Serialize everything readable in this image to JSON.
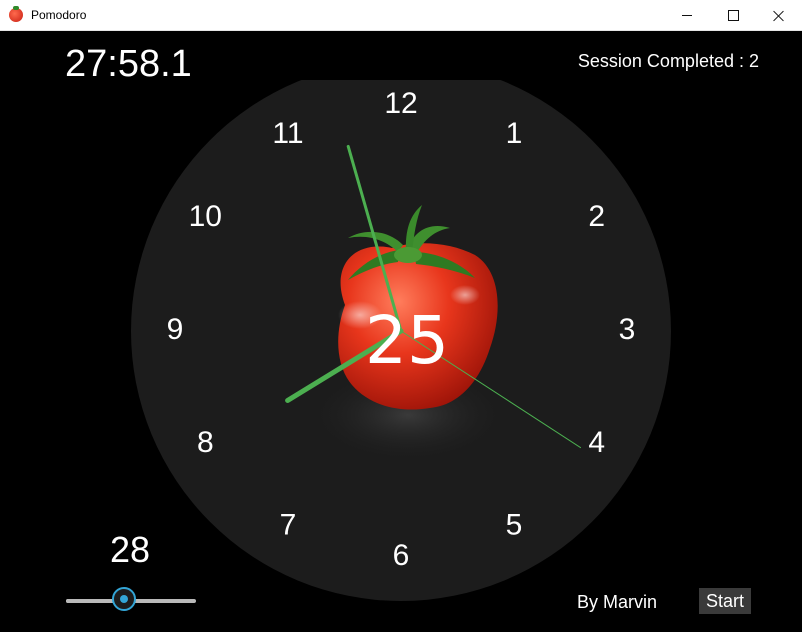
{
  "window": {
    "title": "Pomodoro",
    "icon": "tomato-icon",
    "controls": [
      "minimize-icon",
      "maximize-icon",
      "close-icon"
    ]
  },
  "timer": {
    "display": "27:58.1"
  },
  "session": {
    "label": "Session Completed : 2"
  },
  "clock": {
    "numbers": [
      "12",
      "1",
      "2",
      "3",
      "4",
      "5",
      "6",
      "7",
      "8",
      "9",
      "10",
      "11"
    ],
    "center_label": "25",
    "center_image": "tomato-icon",
    "face_color": "#1c1c1c",
    "hand_color": "#4caf50",
    "time": {
      "hours": 7,
      "minutes": 57,
      "seconds": 20.5
    }
  },
  "duration_slider": {
    "value": "28",
    "fraction": 0.45,
    "accent": "#33a5d6"
  },
  "footer": {
    "credit": "By Marvin",
    "start_label": "Start"
  }
}
